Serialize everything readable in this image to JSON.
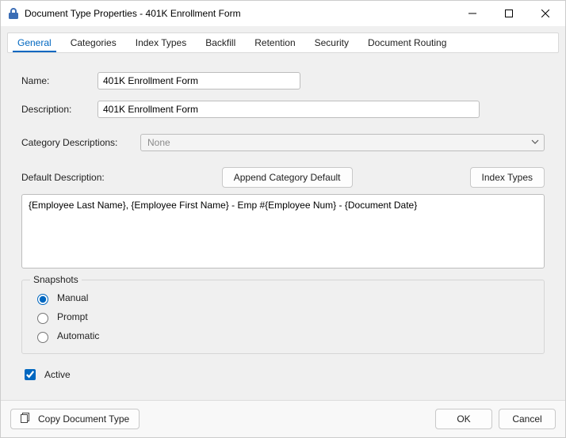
{
  "window": {
    "title": "Document Type Properties  - 401K Enrollment Form"
  },
  "tabs": [
    {
      "label": "General",
      "active": true
    },
    {
      "label": "Categories",
      "active": false
    },
    {
      "label": "Index Types",
      "active": false
    },
    {
      "label": "Backfill",
      "active": false
    },
    {
      "label": "Retention",
      "active": false
    },
    {
      "label": "Security",
      "active": false
    },
    {
      "label": "Document Routing",
      "active": false
    }
  ],
  "form": {
    "name_label": "Name:",
    "name_value": "401K Enrollment Form",
    "description_label": "Description:",
    "description_value": "401K Enrollment Form",
    "category_desc_label": "Category Descriptions:",
    "category_desc_value": "None",
    "default_desc_label": "Default Description:",
    "append_btn": "Append Category Default",
    "index_types_btn": "Index Types",
    "default_desc_value": "{Employee Last Name}, {Employee First Name} - Emp #{Employee Num} - {Document Date}"
  },
  "snapshots": {
    "legend": "Snapshots",
    "options": [
      {
        "label": "Manual",
        "checked": true
      },
      {
        "label": "Prompt",
        "checked": false
      },
      {
        "label": "Automatic",
        "checked": false
      }
    ]
  },
  "active": {
    "label": "Active",
    "checked": true
  },
  "footer": {
    "copy_btn": "Copy Document Type",
    "ok_btn": "OK",
    "cancel_btn": "Cancel"
  }
}
